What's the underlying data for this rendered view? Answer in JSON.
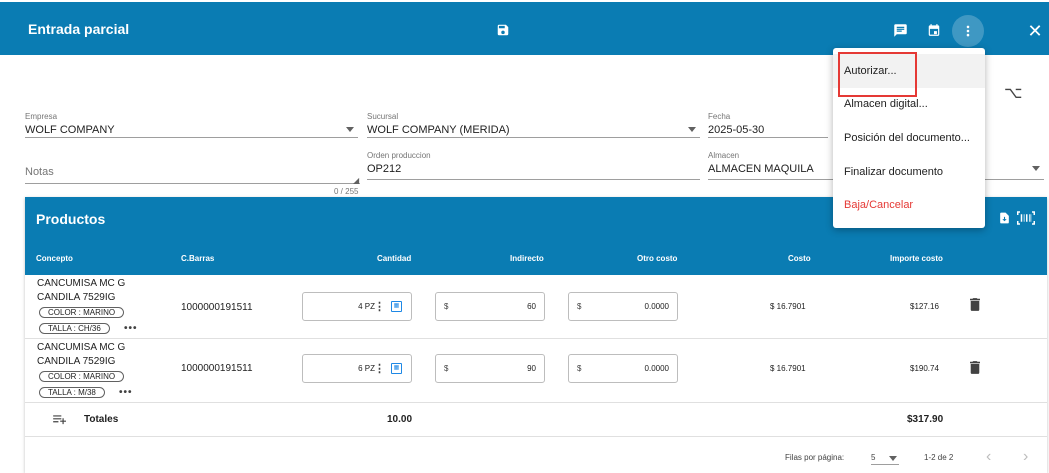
{
  "appbar": {
    "title": "Entrada parcial",
    "icons": [
      "save-icon",
      "comment-icon",
      "calendar-icon",
      "more-vert-icon",
      "close-icon"
    ],
    "close_glyph": "✕"
  },
  "filter_glyph": "⌥",
  "form": {
    "empresa": {
      "label": "Empresa",
      "value": "WOLF COMPANY"
    },
    "sucursal": {
      "label": "Sucursal",
      "value": "WOLF COMPANY (MERIDA)"
    },
    "fecha": {
      "label": "Fecha",
      "value": "2025-05-30"
    },
    "notas": {
      "placeholder": "Notas",
      "counter": "0 / 255"
    },
    "orden": {
      "label": "Orden produccion",
      "value": "OP212"
    },
    "almacen": {
      "label": "Almacen",
      "value": "ALMACEN MAQUILA"
    }
  },
  "products": {
    "title": "Productos",
    "columns": [
      "Concepto",
      "C.Barras",
      "Cantidad",
      "Indirecto",
      "Otro costo",
      "Costo",
      "Importe costo"
    ],
    "rows": [
      {
        "line1": "CANCUMISA MC G",
        "line2": "CANDILA 7529IG",
        "chip1": "COLOR : MARINO",
        "chip2": "TALLA : CH/36",
        "more": "•••",
        "barcode": "1000000191511",
        "qty": "4 PZ",
        "indirect_prefix": "$",
        "indirect": "60",
        "other_prefix": "$",
        "other": "0.0000",
        "cost": "$ 16.7901",
        "amount": "$127.16"
      },
      {
        "line1": "CANCUMISA MC G",
        "line2": "CANDILA 7529IG",
        "chip1": "COLOR : MARINO",
        "chip2": "TALLA : M/38",
        "more": "•••",
        "barcode": "1000000191511",
        "qty": "6 PZ",
        "indirect_prefix": "$",
        "indirect": "90",
        "other_prefix": "$",
        "other": "0.0000",
        "cost": "$ 16.7901",
        "amount": "$190.74"
      }
    ],
    "totals": {
      "label": "Totales",
      "qty": "10.00",
      "amount": "$317.90"
    },
    "pager": {
      "rows_label": "Filas por página:",
      "per_page": "5",
      "range": "1-2 de 2",
      "prev": "‹",
      "next": "›"
    }
  },
  "menu": {
    "items": [
      "Autorizar...",
      "Almacen digital...",
      "Posición del documento...",
      "Finalizar documento",
      "Baja/Cancelar"
    ],
    "highlighted_index": 0,
    "danger_color": "#e53935"
  },
  "colors": {
    "primary": "#0a7cb3",
    "accent": "#1e88e5"
  }
}
